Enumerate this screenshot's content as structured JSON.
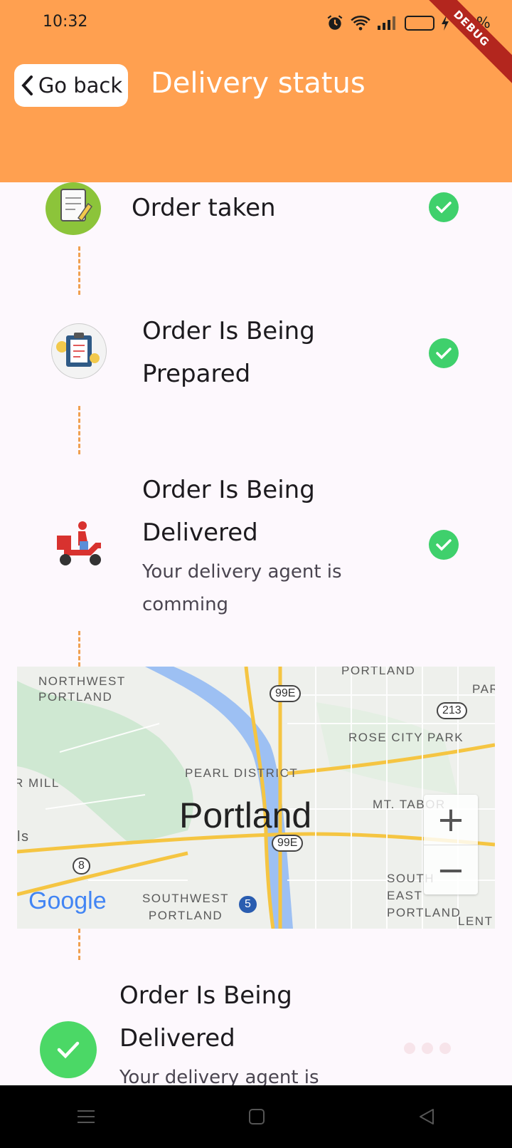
{
  "status_bar": {
    "time": "10:32",
    "battery": "11%"
  },
  "debug_banner": "DEBUG",
  "header": {
    "back_label": "Go back",
    "title": "Delivery status"
  },
  "steps": [
    {
      "title": "Order taken",
      "subtitle": "",
      "icon": "notepad-pencil-icon",
      "done": true
    },
    {
      "title": "Order Is Being Prepared",
      "subtitle": "",
      "icon": "clipboard-gear-icon",
      "done": true
    },
    {
      "title": "Order Is Being Delivered",
      "subtitle": "Your delivery agent is comming",
      "icon": "delivery-scooter-icon",
      "done": true
    },
    {
      "title": "Order Is Being Delivered",
      "subtitle": "Your delivery agent is",
      "icon": "check-circle-icon",
      "done": false
    }
  ],
  "map": {
    "city": "Portland",
    "labels": [
      "NORTHWEST PORTLAND",
      "PORTLAND",
      "PAR",
      "ROSE CITY PARK",
      "PEARL DISTRICT",
      "R MILL",
      "MT. TABOR",
      "SOUTH EAST PORTLAND",
      "SOUTHWEST PORTLAND",
      "LENT",
      "ls"
    ],
    "shields": [
      "99E",
      "213",
      "99E",
      "8",
      "5"
    ],
    "zoom_in": "+",
    "zoom_out": "−",
    "attribution": "Google"
  },
  "colors": {
    "appbar": "#ffa050",
    "check": "#3fd06c",
    "connector": "#f0a050"
  }
}
